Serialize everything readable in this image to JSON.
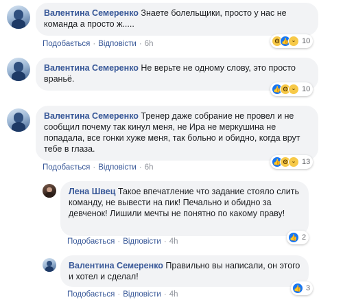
{
  "comments": [
    {
      "author": "Валентина Семеренко",
      "text": "Знаете болельщики, просто у нас не команда а просто ж.....",
      "like_label": "Подобається",
      "reply_label": "Відповісти",
      "time": "6h",
      "reaction_count": "10",
      "reactions": [
        "wow",
        "like",
        "sad"
      ]
    },
    {
      "author": "Валентина Семеренко",
      "text": "Не верьте не одному слову, это просто враньё.",
      "like_label": "Подобається",
      "reply_label": "Відповісти",
      "time": "6h",
      "reaction_count": "10",
      "reactions": [
        "like",
        "wow",
        "sad"
      ]
    },
    {
      "author": "Валентина Семеренко",
      "text": "Тренер даже собрание не провел и не сообщил почему так кинул меня, не Ира не меркушина не попадала, все гонки хуже меня, так больно и обидно, когда врут тебе в глаза.",
      "like_label": "Подобається",
      "reply_label": "Відповісти",
      "time": "6h",
      "reaction_count": "13",
      "reactions": [
        "like",
        "wow",
        "sad"
      ]
    },
    {
      "author": "Лена Швец",
      "text": "Такое впечатление что задание стояло слить команду, не вывести на пик! Печально и обидно за девченок! Лишили мечты не понятно по какому праву!",
      "like_label": "Подобається",
      "reply_label": "Відповісти",
      "time": "4h",
      "reaction_count": "2",
      "reactions": [
        "like"
      ]
    },
    {
      "author": "Валентина Семеренко",
      "text": "Правильно вы написали, он этого и хотел и сделал!",
      "like_label": "Подобається",
      "reply_label": "Відповісти",
      "time": "4h",
      "reaction_count": "3",
      "reactions": [
        "like"
      ]
    }
  ],
  "colors": {
    "link": "#385898",
    "bubble": "#f2f3f5",
    "meta": "#90949c",
    "like": "#1877f2",
    "emoji": "#f7c948"
  }
}
